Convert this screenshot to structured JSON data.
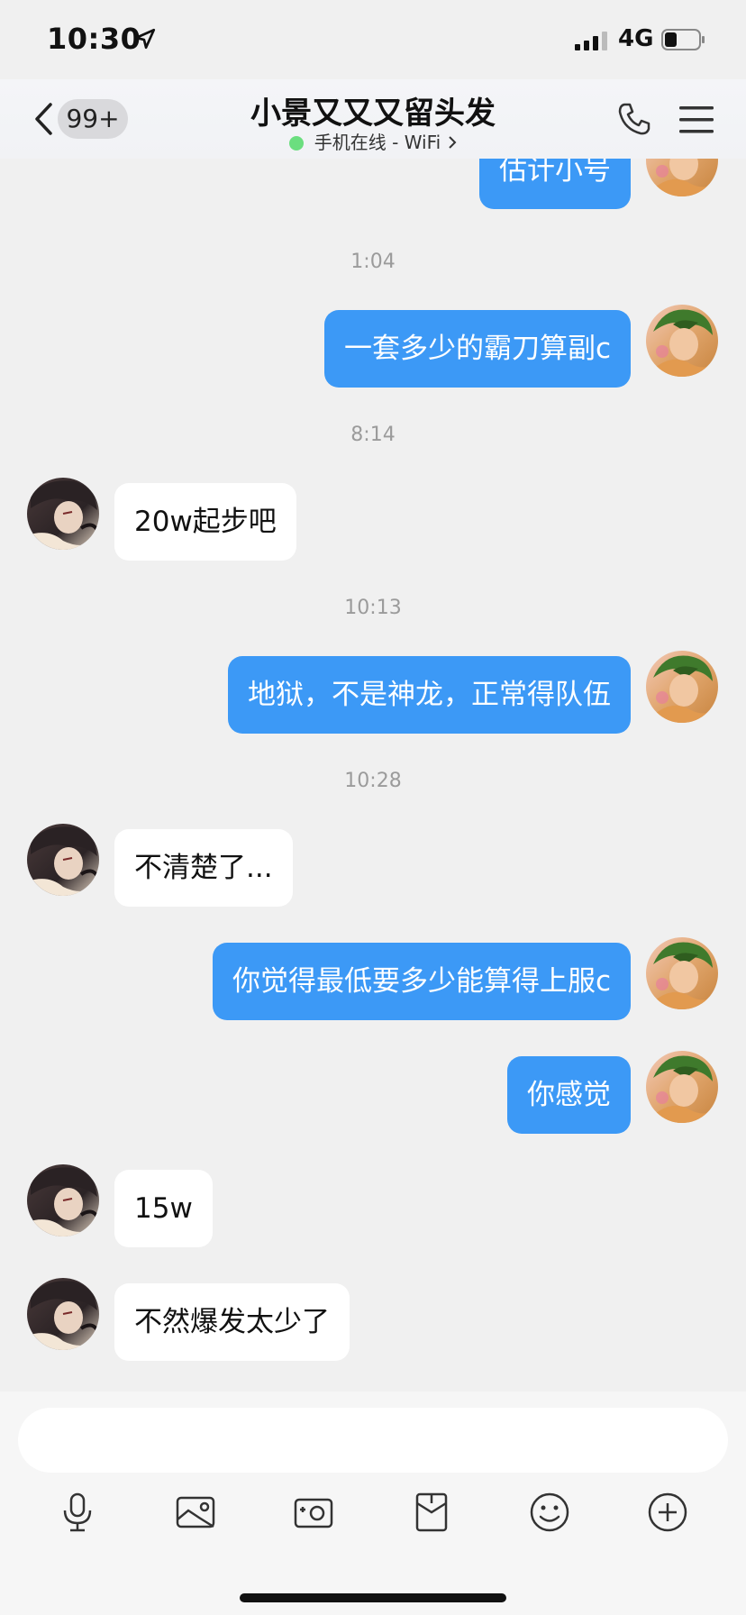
{
  "status_bar": {
    "time": "10:30",
    "network": "4G",
    "icons": [
      "location-arrow-icon",
      "signal-bars-icon",
      "battery-icon"
    ]
  },
  "nav": {
    "badge": "99+",
    "title": "小景又又又留头发",
    "subtitle": "手机在线 - WiFi",
    "status_color": "#6bde7f",
    "icons": [
      "back-chevron-icon",
      "phone-icon",
      "menu-icon"
    ]
  },
  "chat": {
    "timestamps": [
      "1:04",
      "8:14",
      "10:13",
      "10:28"
    ],
    "messages": [
      {
        "side": "me",
        "text": "估计小号"
      },
      {
        "side": "me",
        "text": "一套多少的霸刀算副c"
      },
      {
        "side": "them",
        "text": "20w起步吧"
      },
      {
        "side": "me",
        "text": "地狱，不是神龙，正常得队伍"
      },
      {
        "side": "them",
        "text": "不清楚了..."
      },
      {
        "side": "me",
        "text": "你觉得最低要多少能算得上服c"
      },
      {
        "side": "me",
        "text": "你感觉"
      },
      {
        "side": "them",
        "text": "15w"
      },
      {
        "side": "them",
        "text": "不然爆发太少了"
      }
    ]
  },
  "input": {
    "value": "",
    "tools": [
      "microphone-icon",
      "image-icon",
      "camera-icon",
      "red-packet-icon",
      "emoji-icon",
      "plus-icon"
    ]
  },
  "colors": {
    "my_bubble": "#3c99f6",
    "their_bubble": "#ffffff",
    "background": "#f0f0f0"
  }
}
